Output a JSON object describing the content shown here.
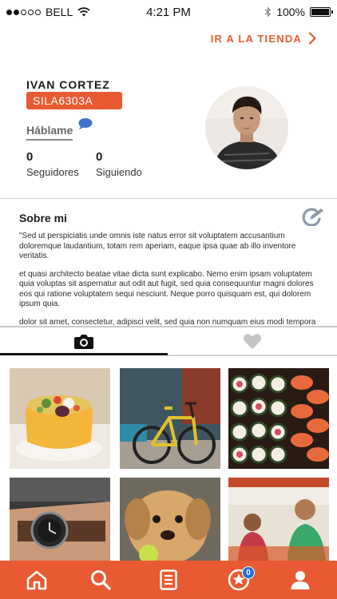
{
  "status_bar": {
    "carrier": "BELL",
    "time": "4:21 PM",
    "battery": "100%",
    "battery_level": 1.0,
    "signal_bars": 2,
    "signal_total": 5
  },
  "store_link": {
    "label": "IR A LA TIENDA"
  },
  "profile": {
    "name": "IVAN CORTEZ",
    "code": "SILA6303A",
    "chat_label": "Háblame",
    "followers": {
      "count": "0",
      "label": "Seguidores"
    },
    "following": {
      "count": "0",
      "label": "Siguiendo"
    }
  },
  "about": {
    "title": "Sobre mi",
    "paragraphs": [
      "\"Sed ut perspiciatis unde omnis iste natus error sit voluptatem accusantium doloremque laudantium, totam rem aperiam, eaque ipsa quae ab illo inventore veritatis.",
      "et quasi architecto beatae vitae dicta sunt explicabo. Nemo enim ipsam voluptatem quia voluptas sit aspernatur aut odit aut fugit, sed quia consequuntur magni dolores eos qui ratione voluptatem sequi nesciunt. Neque porro quisquam est, qui dolorem ipsum quia.",
      "dolor sit amet, consectetur, adipisci velit, sed quia non numquam eius modi tempora"
    ]
  },
  "tabs": [
    {
      "icon": "camera-icon",
      "active": true
    },
    {
      "icon": "heart-icon",
      "active": false
    }
  ],
  "photos": [
    {
      "subject": "food-causa"
    },
    {
      "subject": "bicycle"
    },
    {
      "subject": "sushi"
    },
    {
      "subject": "wristwatch"
    },
    {
      "subject": "puppy"
    },
    {
      "subject": "market-people"
    }
  ],
  "bottom_nav": {
    "items": [
      "home-icon",
      "search-icon",
      "list-icon",
      "star-icon",
      "profile-icon"
    ],
    "badge": "0"
  },
  "colors": {
    "accent": "#ea5a32",
    "badge": "#1e6fd9",
    "chat_bubble": "#3a73c9"
  }
}
